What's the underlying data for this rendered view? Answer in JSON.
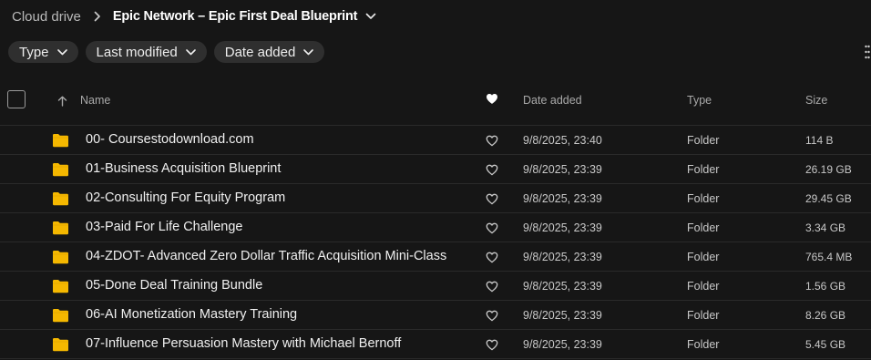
{
  "breadcrumb": {
    "root": "Cloud drive",
    "current": "Epic Network – Epic First Deal Blueprint"
  },
  "filters": [
    {
      "label": "Type"
    },
    {
      "label": "Last modified"
    },
    {
      "label": "Date added"
    }
  ],
  "columns": {
    "name": "Name",
    "date_added": "Date added",
    "type": "Type",
    "size": "Size"
  },
  "rows": [
    {
      "name": "00- Coursestodownload.com",
      "date": "9/8/2025, 23:40",
      "type": "Folder",
      "size": "114 B"
    },
    {
      "name": "01-Business Acquisition Blueprint",
      "date": "9/8/2025, 23:39",
      "type": "Folder",
      "size": "26.19 GB"
    },
    {
      "name": "02-Consulting For Equity Program",
      "date": "9/8/2025, 23:39",
      "type": "Folder",
      "size": "29.45 GB"
    },
    {
      "name": "03-Paid For Life Challenge",
      "date": "9/8/2025, 23:39",
      "type": "Folder",
      "size": "3.34 GB"
    },
    {
      "name": "04-ZDOT- Advanced Zero Dollar Traffic Acquisition Mini-Class",
      "date": "9/8/2025, 23:39",
      "type": "Folder",
      "size": "765.4 MB"
    },
    {
      "name": "05-Done Deal Training Bundle",
      "date": "9/8/2025, 23:39",
      "type": "Folder",
      "size": "1.56 GB"
    },
    {
      "name": "06-AI Monetization Mastery Training",
      "date": "9/8/2025, 23:39",
      "type": "Folder",
      "size": "8.26 GB"
    },
    {
      "name": "07-Influence Persuasion Mastery with Michael Bernoff",
      "date": "9/8/2025, 23:39",
      "type": "Folder",
      "size": "5.45 GB"
    }
  ],
  "colors": {
    "background": "#161616",
    "chip": "#2f2f2f",
    "folder": "#f5b800"
  },
  "icons": [
    "chevron-right-icon",
    "chevron-down-icon",
    "more-vertical-icon",
    "sort-arrow-up-icon",
    "heart-icon",
    "folder-icon"
  ]
}
